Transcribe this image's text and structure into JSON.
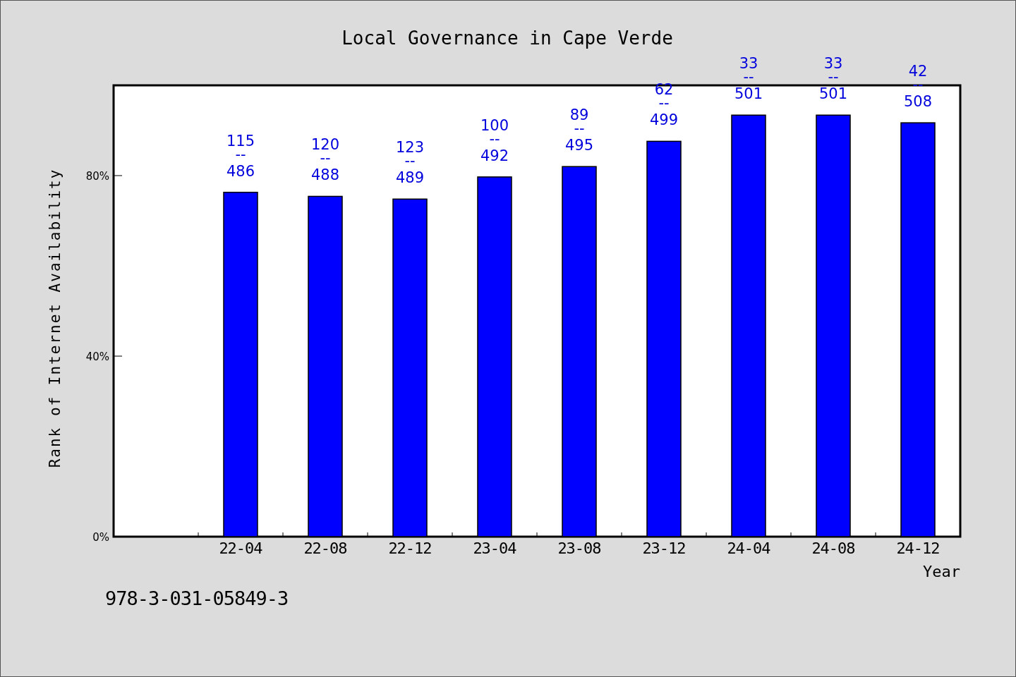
{
  "chart_data": {
    "type": "bar",
    "title": "Local Governance in Cape Verde",
    "xlabel": "Year",
    "ylabel": "Rank of Internet Availability",
    "categories": [
      "22-04",
      "22-08",
      "22-12",
      "23-04",
      "23-08",
      "23-12",
      "24-04",
      "24-08",
      "24-12"
    ],
    "series": [
      {
        "color": "#0000ff",
        "values": [
          0.763,
          0.754,
          0.748,
          0.797,
          0.82,
          0.876,
          0.934,
          0.934,
          0.917
        ]
      }
    ],
    "ylim": [
      0,
      1
    ],
    "yticks": [
      {
        "value": 0,
        "label": "0%"
      },
      {
        "value": 0.4,
        "label": "40%"
      },
      {
        "value": 0.8,
        "label": "80%"
      }
    ],
    "value_labels": [
      [
        "115",
        "--",
        "486"
      ],
      [
        "120",
        "--",
        "488"
      ],
      [
        "123",
        "--",
        "489"
      ],
      [
        "100",
        "--",
        "492"
      ],
      [
        "89",
        "--",
        "495"
      ],
      [
        "62",
        "--",
        "499"
      ],
      [
        "33",
        "--",
        "501"
      ],
      [
        "33",
        "--",
        "501"
      ],
      [
        "42",
        "--",
        "508"
      ]
    ]
  },
  "footer_code": "978-3-031-05849-3"
}
